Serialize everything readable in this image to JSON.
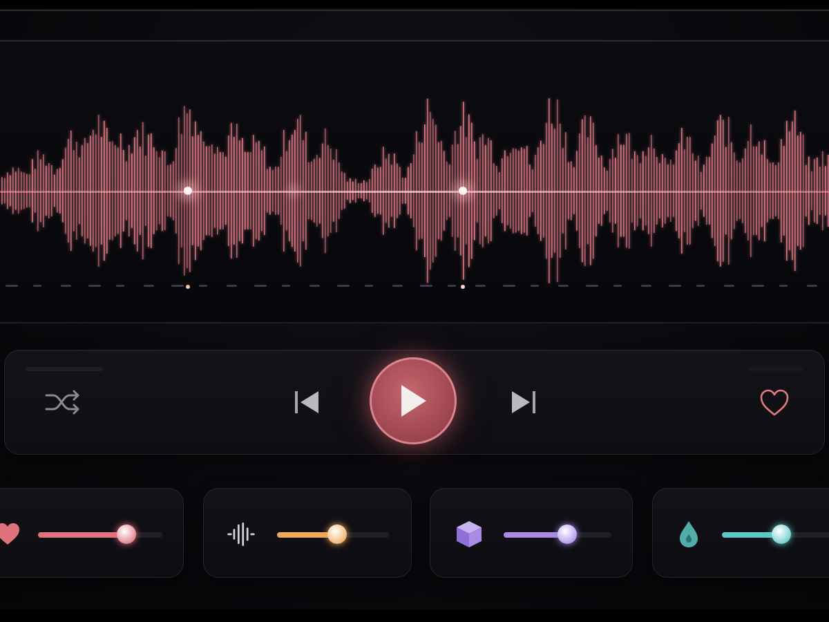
{
  "colors": {
    "wave": "#e8808a",
    "wave_glow": "#ffd2d6",
    "accent_red": "#d96c74",
    "accent_orange": "#f2a85a",
    "accent_purple": "#a98be6",
    "accent_teal": "#5ec8c6"
  },
  "controls": {
    "shuffle_icon": "shuffle-icon",
    "prev_icon": "skip-previous-icon",
    "play_icon": "play-icon",
    "next_icon": "skip-next-icon",
    "favorite_icon": "heart-outline-icon"
  },
  "modules": [
    {
      "icon": "heart-icon",
      "color": "#e0727c",
      "value": 0.71
    },
    {
      "icon": "waveform-bars-icon",
      "color": "#f2a85a",
      "value": 0.54
    },
    {
      "icon": "cube-icon",
      "color": "#a98be6",
      "value": 0.59
    },
    {
      "icon": "drop-icon",
      "color": "#5ec8c6",
      "value": 0.45
    }
  ]
}
